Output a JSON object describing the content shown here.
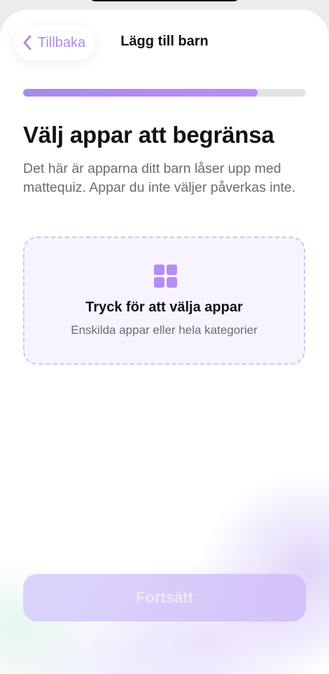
{
  "header": {
    "back_label": "Tillbaka",
    "title": "Lägg till barn"
  },
  "progress": {
    "fraction": 0.83
  },
  "main": {
    "heading": "Välj appar att begränsa",
    "description": "Det här är apparna ditt barn låser upp med mattequiz. Appar du inte väljer påverkas inte.",
    "picker": {
      "title": "Tryck för att välja appar",
      "subtitle": "Enskilda appar eller hela kategorier",
      "icon": "grid-icon"
    }
  },
  "footer": {
    "continue_label": "Fortsätt",
    "continue_enabled": false
  },
  "colors": {
    "accent": "#b08be3",
    "progress_fill": "#b08ef0",
    "progress_track": "#e4e4e7",
    "picker_border": "#d3c2f2",
    "picker_background": "#f8f4ff",
    "text_primary": "#111111",
    "text_secondary": "#6b6b70"
  }
}
